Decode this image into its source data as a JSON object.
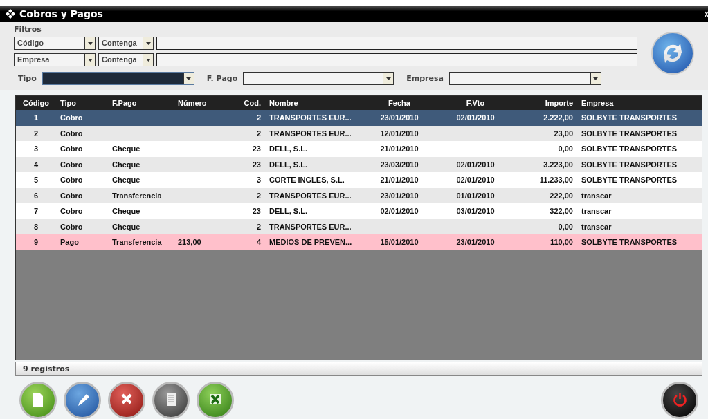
{
  "window": {
    "title": "Cobros y Pagos"
  },
  "filters": {
    "title": "Filtros",
    "rows": [
      {
        "field": "Código",
        "operator": "Contenga",
        "value": ""
      },
      {
        "field": "Empresa",
        "operator": "Contenga",
        "value": ""
      }
    ],
    "selects": [
      {
        "label": "Tipo",
        "focused": true
      },
      {
        "label": "F. Pago",
        "focused": false
      },
      {
        "label": "Empresa",
        "focused": false
      }
    ]
  },
  "table": {
    "columns": [
      "Código",
      "Tipo",
      "F.Pago",
      "Número",
      "Cod.",
      "Nombre",
      "Fecha",
      "F.Vto",
      "Importe",
      "Empresa"
    ],
    "rows": [
      {
        "selected": true,
        "flagged": false,
        "cells": [
          "1",
          "Cobro",
          "",
          "",
          "2",
          "TRANSPORTES EUR...",
          "23/01/2010",
          "02/01/2010",
          "2.222,00",
          "SOLBYTE TRANSPORTES"
        ]
      },
      {
        "selected": false,
        "flagged": false,
        "cells": [
          "2",
          "Cobro",
          "",
          "",
          "2",
          "TRANSPORTES EUR...",
          "12/01/2010",
          "",
          "23,00",
          "SOLBYTE TRANSPORTES"
        ]
      },
      {
        "selected": false,
        "flagged": false,
        "cells": [
          "3",
          "Cobro",
          "Cheque",
          "",
          "23",
          "DELL, S.L.",
          "21/01/2010",
          "",
          "0,00",
          "SOLBYTE TRANSPORTES"
        ]
      },
      {
        "selected": false,
        "flagged": false,
        "cells": [
          "4",
          "Cobro",
          "Cheque",
          "",
          "23",
          "DELL, S.L.",
          "23/03/2010",
          "02/01/2010",
          "3.223,00",
          "SOLBYTE TRANSPORTES"
        ]
      },
      {
        "selected": false,
        "flagged": false,
        "cells": [
          "5",
          "Cobro",
          "Cheque",
          "",
          "3",
          "CORTE INGLES, S.L.",
          "21/01/2010",
          "02/01/2010",
          "11.233,00",
          "SOLBYTE TRANSPORTES"
        ]
      },
      {
        "selected": false,
        "flagged": false,
        "cells": [
          "6",
          "Cobro",
          "Transferencia",
          "",
          "2",
          "TRANSPORTES EUR...",
          "23/01/2010",
          "01/01/2010",
          "222,00",
          "transcar"
        ]
      },
      {
        "selected": false,
        "flagged": false,
        "cells": [
          "7",
          "Cobro",
          "Cheque",
          "",
          "23",
          "DELL, S.L.",
          "02/01/2010",
          "03/01/2010",
          "322,00",
          "transcar"
        ]
      },
      {
        "selected": false,
        "flagged": false,
        "cells": [
          "8",
          "Cobro",
          "Cheque",
          "",
          "2",
          "TRANSPORTES EUR...",
          "",
          "",
          "0,00",
          "transcar"
        ]
      },
      {
        "selected": false,
        "flagged": true,
        "cells": [
          "9",
          "Pago",
          "Transferencia",
          "213,00",
          "4",
          "MEDIOS DE PREVEN...",
          "15/01/2010",
          "23/01/2010",
          "110,00",
          "SOLBYTE TRANSPORTES"
        ]
      }
    ]
  },
  "status_bar": "9 registros",
  "actions": [
    {
      "kind": "new"
    },
    {
      "kind": "edit"
    },
    {
      "kind": "delete"
    },
    {
      "kind": "report"
    },
    {
      "kind": "excel"
    },
    {
      "kind": "power"
    }
  ]
}
